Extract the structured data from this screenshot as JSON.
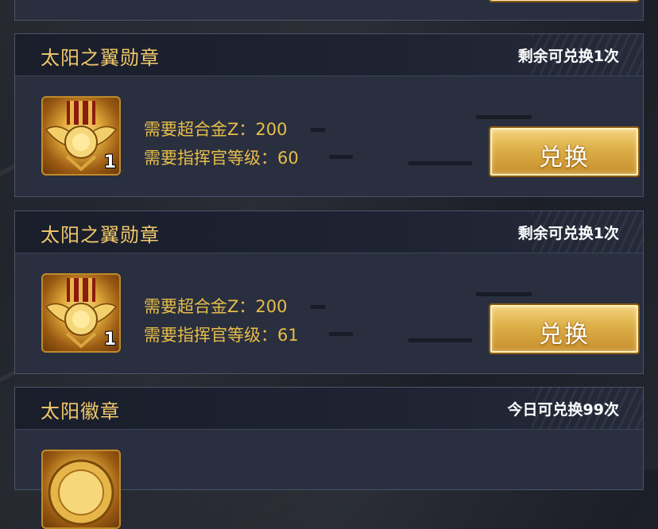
{
  "cards": [
    {
      "title": "太阳之翼勋章",
      "remaining": "剩余可兑换1次",
      "quantity": "1",
      "requirements": [
        "需要超合金Z：200",
        "需要指挥官等级：60"
      ],
      "button_label": "兑换"
    },
    {
      "title": "太阳之翼勋章",
      "remaining": "剩余可兑换1次",
      "quantity": "1",
      "requirements": [
        "需要超合金Z：200",
        "需要指挥官等级：61"
      ],
      "button_label": "兑换"
    },
    {
      "title": "太阳徽章",
      "remaining": "今日可兑换99次"
    }
  ],
  "colors": {
    "title": "#f1c96a",
    "requirement_text": "#e6bd4a",
    "card_bg": "#2a2f3f",
    "button_gold": "#dcae47"
  },
  "icons": [
    "medal-wings-icon",
    "sun-badge-icon"
  ]
}
